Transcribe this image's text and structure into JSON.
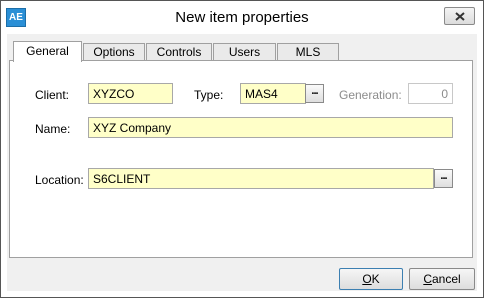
{
  "window": {
    "title": "New item properties",
    "app_icon_text": "AE"
  },
  "tabs": [
    {
      "label": "General",
      "active": true
    },
    {
      "label": "Options",
      "active": false
    },
    {
      "label": "Controls",
      "active": false
    },
    {
      "label": "Users",
      "active": false
    },
    {
      "label": "MLS",
      "active": false
    }
  ],
  "general": {
    "client_label": "Client:",
    "client_value": "XYZCO",
    "type_label": "Type:",
    "type_value": "MAS4",
    "type_browse": "...",
    "generation_label": "Generation:",
    "generation_value": "0",
    "name_label": "Name:",
    "name_value": "XYZ Company",
    "location_label": "Location:",
    "location_value": "S6CLIENT",
    "location_browse": "..."
  },
  "buttons": {
    "ok_first": "O",
    "ok_rest": "K",
    "cancel_first": "C",
    "cancel_rest": "ancel"
  },
  "colors": {
    "field_background": "#ffffc8",
    "default_button_border": "#3c7fb1"
  },
  "icons": {
    "app": "app-icon",
    "close": "close-icon"
  }
}
